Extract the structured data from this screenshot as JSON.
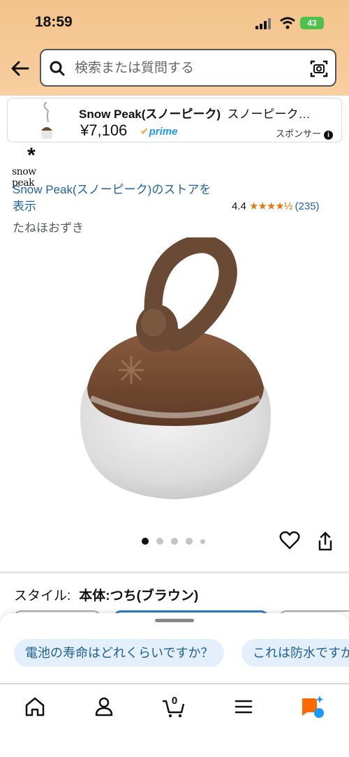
{
  "status": {
    "time": "18:59",
    "battery": "43"
  },
  "search": {
    "placeholder": "検索または質問する"
  },
  "sponsored": {
    "brand": "Snow Peak(スノーピーク)",
    "title_rest": "スノーピーク…",
    "price": "¥7,106",
    "prime": "prime",
    "label": "スポンサー"
  },
  "brand_logo": {
    "mark": "*",
    "word": "snow peak"
  },
  "store_link": "Snow Peak(スノーピーク)のストアを表示",
  "rating": {
    "value": "4.4",
    "stars": "★★★★½",
    "count": "(235)"
  },
  "product_name": "たねほおずき",
  "gallery": {
    "dot_count": 5,
    "active_index": 0
  },
  "style": {
    "label": "スタイル:",
    "value": "本体:つち(ブラウン)"
  },
  "suggestions": [
    "電池の寿命はどれくらいですか？",
    "これは防水ですか"
  ],
  "tabs": [
    "home",
    "account",
    "cart",
    "menu",
    "rufus"
  ],
  "cart_count": "0",
  "colors": {
    "brand_link": "#2162a1",
    "star": "#e47911",
    "prime": "#1a98ff",
    "chip_bg": "#e3f0fb",
    "header": "#f3c48c"
  }
}
